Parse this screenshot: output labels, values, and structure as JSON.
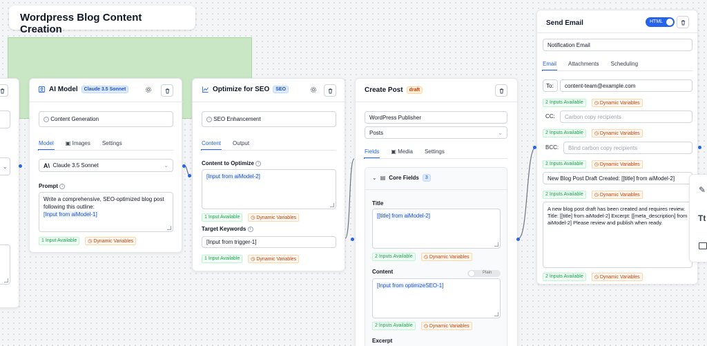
{
  "canvas": {
    "title": "Wordpress Blog Content Creation"
  },
  "ai_model": {
    "title": "AI Model",
    "badge": "Claude 3.5 Sonnet",
    "description": "Content Generation",
    "tabs": [
      "Model",
      "Images",
      "Settings"
    ],
    "model_select": "Claude 3.5 Sonnet",
    "prompt_label": "Prompt",
    "prompt_text": "Write a comprehensive, SEO-optimized blog post following this outline:",
    "prompt_ref": "[Input from aiModel-1]",
    "inputs_chip": "1 Input Available",
    "dynamic_chip": "Dynamic Variables"
  },
  "seo": {
    "title": "Optimize for SEO",
    "badge": "SEO",
    "description": "SEO Enhancement",
    "tabs": [
      "Content",
      "Output"
    ],
    "content_label": "Content to Optimize",
    "content_value": "[Input from aiModel-2]",
    "inputs_chip": "1 Input Available",
    "dynamic_chip": "Dynamic Variables",
    "keywords_label": "Target Keywords",
    "keywords_value": "[Input from trigger-1]",
    "inputs_chip2": "1 Input Available",
    "dynamic_chip2": "Dynamic Variables"
  },
  "create_post": {
    "title": "Create Post",
    "badge": "draft",
    "publisher": "WordPress Publisher",
    "type_select": "Posts",
    "tabs": [
      "Fields",
      "Media",
      "Settings"
    ],
    "section_title": "Core Fields",
    "section_count": "3",
    "title_label": "Title",
    "title_value": "[[title] from aiModel-2]",
    "inputs_chip": "2 Inputs Available",
    "dynamic_chip": "Dynamic Variables",
    "content_label": "Content",
    "plain_toggle": "Plain",
    "content_value": "[Input from optimizeSEO-1]",
    "inputs_chip2": "2 Inputs Available",
    "dynamic_chip2": "Dynamic Variables",
    "excerpt_label": "Excerpt"
  },
  "send_email": {
    "title": "Send Email",
    "html_toggle": "HTML",
    "name_value": "Notification Email",
    "tabs": [
      "Email",
      "Attachments",
      "Scheduling"
    ],
    "to_label": "To:",
    "to_value": "content-team@example.com",
    "to_inputs": "2 Inputs Available",
    "to_dynamic": "Dynamic Variables",
    "cc_label": "CC:",
    "cc_placeholder": "Carbon copy recipients",
    "cc_inputs": "2 Inputs Available",
    "cc_dynamic": "Dynamic Variables",
    "bcc_label": "BCC:",
    "bcc_placeholder": "Blind carbon copy recipients",
    "bcc_inputs": "2 Inputs Available",
    "bcc_dynamic": "Dynamic Variables",
    "subject_value": "New Blog Post Draft Created: [[title] from aiModel-2]",
    "subject_inputs": "2 Inputs Available",
    "subject_dynamic": "Dynamic Variables",
    "body_text": "A new blog post draft has been created and requires review. Title: [[title] from aiModel-2] Excerpt: [[meta_description] from aiModel-2] Please review and publish when ready.",
    "body_inputs": "2 Inputs Available",
    "body_dynamic": "Dynamic Variables"
  },
  "right_toolbar": {
    "text_tool": "Tt"
  },
  "colors": {
    "accent": "#2563eb",
    "green": "#16a34a",
    "orange": "#c2410c",
    "node_bg": "#c9e7c4"
  }
}
